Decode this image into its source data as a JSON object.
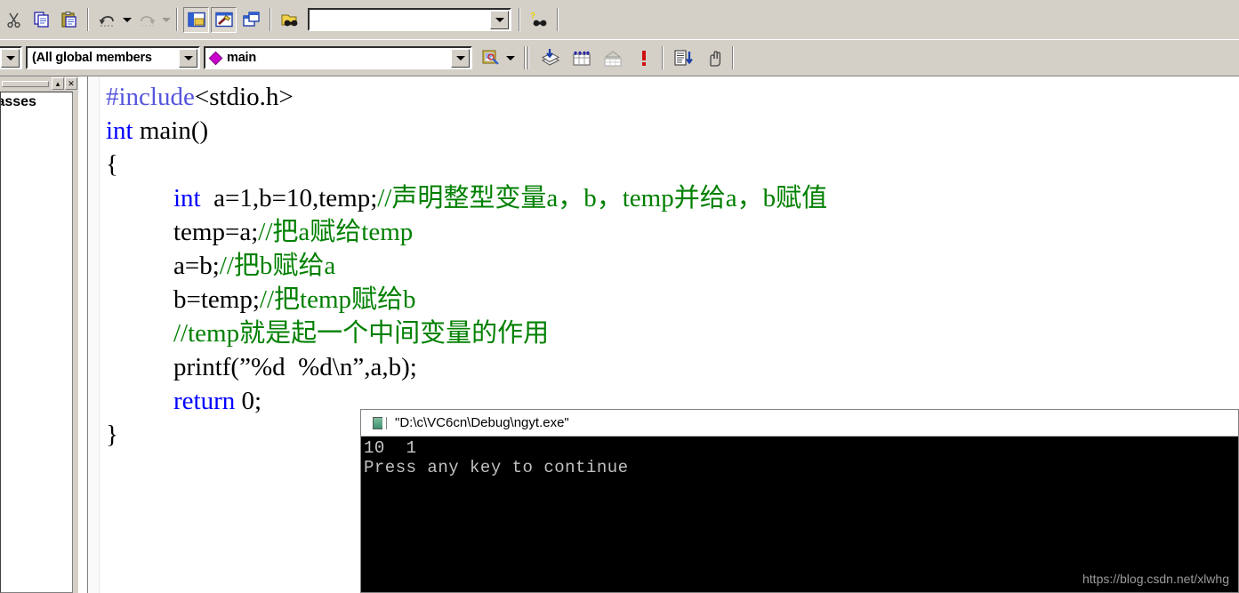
{
  "app": {
    "name": "Microsoft Visual C++ 6.0"
  },
  "toolbar_top": {
    "buttons": [
      {
        "name": "cut-icon",
        "label": "Cut"
      },
      {
        "name": "copy-icon",
        "label": "Copy"
      },
      {
        "name": "paste-icon",
        "label": "Paste"
      },
      {
        "name": "undo-icon",
        "label": "Undo"
      },
      {
        "name": "redo-icon",
        "label": "Redo"
      },
      {
        "name": "workspace-icon",
        "label": "Workspace"
      },
      {
        "name": "output-icon",
        "label": "Output"
      },
      {
        "name": "window-list-icon",
        "label": "Window List"
      },
      {
        "name": "find-in-files-icon",
        "label": "Find in Files"
      }
    ],
    "find_combo": {
      "value": "",
      "placeholder": ""
    },
    "help_button_label": "Search help"
  },
  "toolbar_second": {
    "blank_combo": {
      "value": ""
    },
    "members_combo": {
      "value": "(All global members"
    },
    "symbol_combo": {
      "value": "main",
      "icon": "diamond-member-icon"
    },
    "wizard_button_label": "ClassWizard",
    "buttons": [
      {
        "name": "compile-icon",
        "label": "Compile"
      },
      {
        "name": "build-icon",
        "label": "Build"
      },
      {
        "name": "stop-build-icon",
        "label": "Stop Build"
      },
      {
        "name": "execute-program-icon",
        "label": "Execute Program"
      },
      {
        "name": "go-icon",
        "label": "Go"
      },
      {
        "name": "insert-breakpoint-icon",
        "label": "Insert/Remove Breakpoint"
      }
    ]
  },
  "left_pane": {
    "title_buttons": [
      {
        "name": "minimize-pane-button",
        "glyph": "▴"
      },
      {
        "name": "close-pane-button",
        "glyph": "✕"
      }
    ],
    "label": "lasses"
  },
  "editor": {
    "lines": [
      {
        "tokens": [
          {
            "cls": "pp",
            "t": "#include"
          },
          {
            "cls": "",
            "t": "<stdio.h>"
          }
        ]
      },
      {
        "tokens": [
          {
            "cls": "kw",
            "t": "int"
          },
          {
            "cls": "",
            "t": " main()"
          }
        ]
      },
      {
        "tokens": [
          {
            "cls": "",
            "t": "{"
          }
        ]
      },
      {
        "tokens": [
          {
            "cls": "ind",
            "t": ""
          },
          {
            "cls": "kw",
            "t": "int"
          },
          {
            "cls": "",
            "t": "  a=1,b=10,temp;"
          },
          {
            "cls": "cmt",
            "t": "//声明整型变量a，b，temp并给a，b赋值"
          }
        ]
      },
      {
        "tokens": [
          {
            "cls": "ind",
            "t": ""
          },
          {
            "cls": "",
            "t": "temp=a;"
          },
          {
            "cls": "cmt",
            "t": "//把a赋给temp"
          }
        ]
      },
      {
        "tokens": [
          {
            "cls": "ind",
            "t": ""
          },
          {
            "cls": "",
            "t": "a=b;"
          },
          {
            "cls": "cmt",
            "t": "//把b赋给a"
          }
        ]
      },
      {
        "tokens": [
          {
            "cls": "ind",
            "t": ""
          },
          {
            "cls": "",
            "t": "b=temp;"
          },
          {
            "cls": "cmt",
            "t": "//把temp赋给b"
          }
        ]
      },
      {
        "tokens": [
          {
            "cls": "ind",
            "t": ""
          },
          {
            "cls": "cmt",
            "t": "//temp就是起一个中间变量的作用"
          }
        ]
      },
      {
        "tokens": [
          {
            "cls": "ind",
            "t": ""
          },
          {
            "cls": "",
            "t": "printf(”%d  %d\\n”,a,b);"
          }
        ]
      },
      {
        "tokens": [
          {
            "cls": "ind",
            "t": ""
          },
          {
            "cls": "kw",
            "t": "return"
          },
          {
            "cls": "",
            "t": " 0;"
          }
        ]
      },
      {
        "tokens": [
          {
            "cls": "",
            "t": "}"
          }
        ]
      }
    ]
  },
  "console": {
    "title": "\"D:\\c\\VC6cn\\Debug\\ngyt.exe\"",
    "output_line_1": "10  1",
    "output_line_2": "Press any key to continue"
  },
  "watermark": {
    "text": "https://blog.csdn.net/xlwhg"
  },
  "colors": {
    "keyword": "#0000ff",
    "preprocessor": "#5555dd",
    "comment": "#008000",
    "console_bg": "#000000",
    "console_fg": "#c0c0c0",
    "chrome": "#d4d0c8",
    "accent_member": "#cc00cc"
  }
}
